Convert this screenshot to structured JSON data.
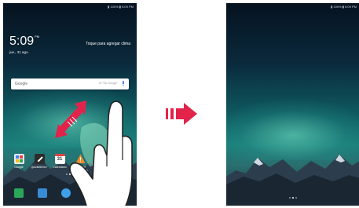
{
  "left_screen": {
    "status_text": "▮ 100% ▮ 5:09 PM",
    "clock": {
      "time": "5:09",
      "ampm": "PM",
      "date": "jue., 31 ago."
    },
    "weather_prompt": "Toque para agregar clima",
    "search": {
      "brand": "Google",
      "hint": "Di \"Ok Google\""
    },
    "apps": [
      {
        "label": "Google",
        "color": "#e8eaf0",
        "icon": "google-folder-icon"
      },
      {
        "label": "QuickMemo+",
        "color": "#2b2b2b",
        "icon": "quickmemo-icon"
      },
      {
        "label": "Calendario",
        "color": "#ffffff",
        "icon": "calendar-icon",
        "badge": "31"
      },
      {
        "label": "Alerta de Emergencia",
        "color": "#f28c28",
        "icon": "emergency-alert-icon"
      }
    ],
    "dock": [
      {
        "icon": "contacts-icon",
        "color": "#2aa65a"
      },
      {
        "icon": "messaging-icon",
        "color": "#3a8bd6"
      },
      {
        "icon": "browser-icon",
        "color": "#3f9ee8"
      },
      {
        "icon": "camera-icon",
        "color": "#e8eef6"
      },
      {
        "icon": "gallery-icon",
        "color": "#f05f6f"
      }
    ],
    "pager_active": 1
  },
  "right_screen": {
    "status_text": "▮ 100% ▮ 5:09 PM",
    "pager_active": 1
  },
  "colors": {
    "arrow": "#e2234a"
  }
}
